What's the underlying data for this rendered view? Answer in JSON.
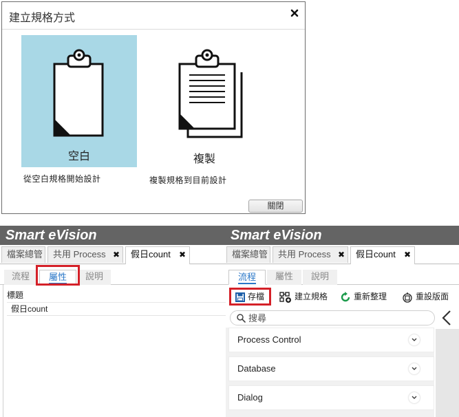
{
  "dialog": {
    "title": "建立規格方式",
    "blank_label": "空白",
    "blank_desc": "從空白規格開始設計",
    "copy_label": "複製",
    "copy_desc": "複製規格到目前設計",
    "close_label": "關閉"
  },
  "left_panel": {
    "brand": "Smart eVision",
    "tabs": [
      "檔案總管",
      "共用 Process",
      "假日count"
    ],
    "subtabs": [
      "流程",
      "屬性",
      "說明"
    ],
    "field_label": "標題",
    "field_value": "假日count"
  },
  "right_panel": {
    "brand": "Smart eVision",
    "tabs": [
      "檔案總管",
      "共用 Process",
      "假日count"
    ],
    "subtabs": [
      "流程",
      "屬性",
      "說明"
    ],
    "toolbar": {
      "save": "存檔",
      "create_spec": "建立規格",
      "refresh": "重新整理",
      "reset_layout": "重設版面"
    },
    "search_placeholder": "搜尋",
    "categories": [
      "Process Control",
      "Database",
      "Dialog"
    ]
  },
  "colors": {
    "highlight": "#d42028",
    "selected_option": "#a9d8e6",
    "brand_bar": "#646464",
    "active_tab": "#2b78c8"
  }
}
